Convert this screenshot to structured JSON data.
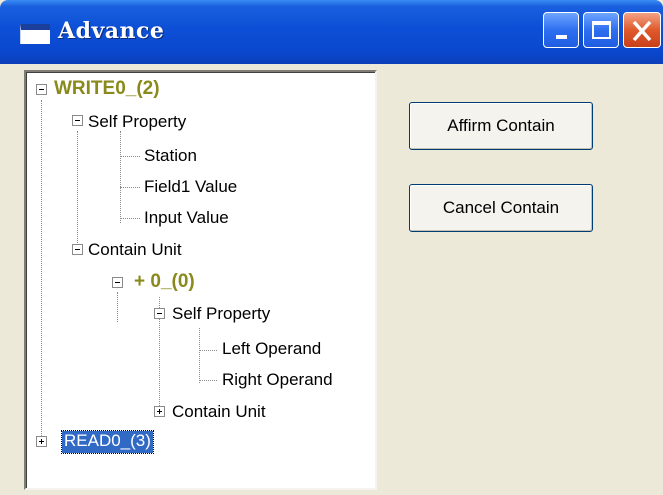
{
  "window": {
    "title": "Advance",
    "controls": {
      "minimize": "minimize",
      "maximize": "maximize",
      "close": "close"
    }
  },
  "tree": {
    "root_write": "WRITE0_(2)",
    "write_self_property": "Self Property",
    "station": "Station",
    "field1_value": "Field1 Value",
    "input_value": "Input Value",
    "write_contain_unit": "Contain Unit",
    "plus_node": "+ 0_(0)",
    "plus_self_property": "Self Property",
    "left_operand": "Left Operand",
    "right_operand": "Right Operand",
    "plus_contain_unit": "Contain Unit",
    "root_read": "READ0_(3)",
    "selected_node": "READ0_(3)"
  },
  "buttons": {
    "affirm": "Affirm Contain",
    "cancel": "Cancel Contain"
  },
  "colors": {
    "titlebar": "#0c4fd6",
    "window_bg": "#ece9d8",
    "bold_node_text": "#8a8a1c",
    "selection": "#316ac5",
    "close_button": "#e05a2c"
  }
}
